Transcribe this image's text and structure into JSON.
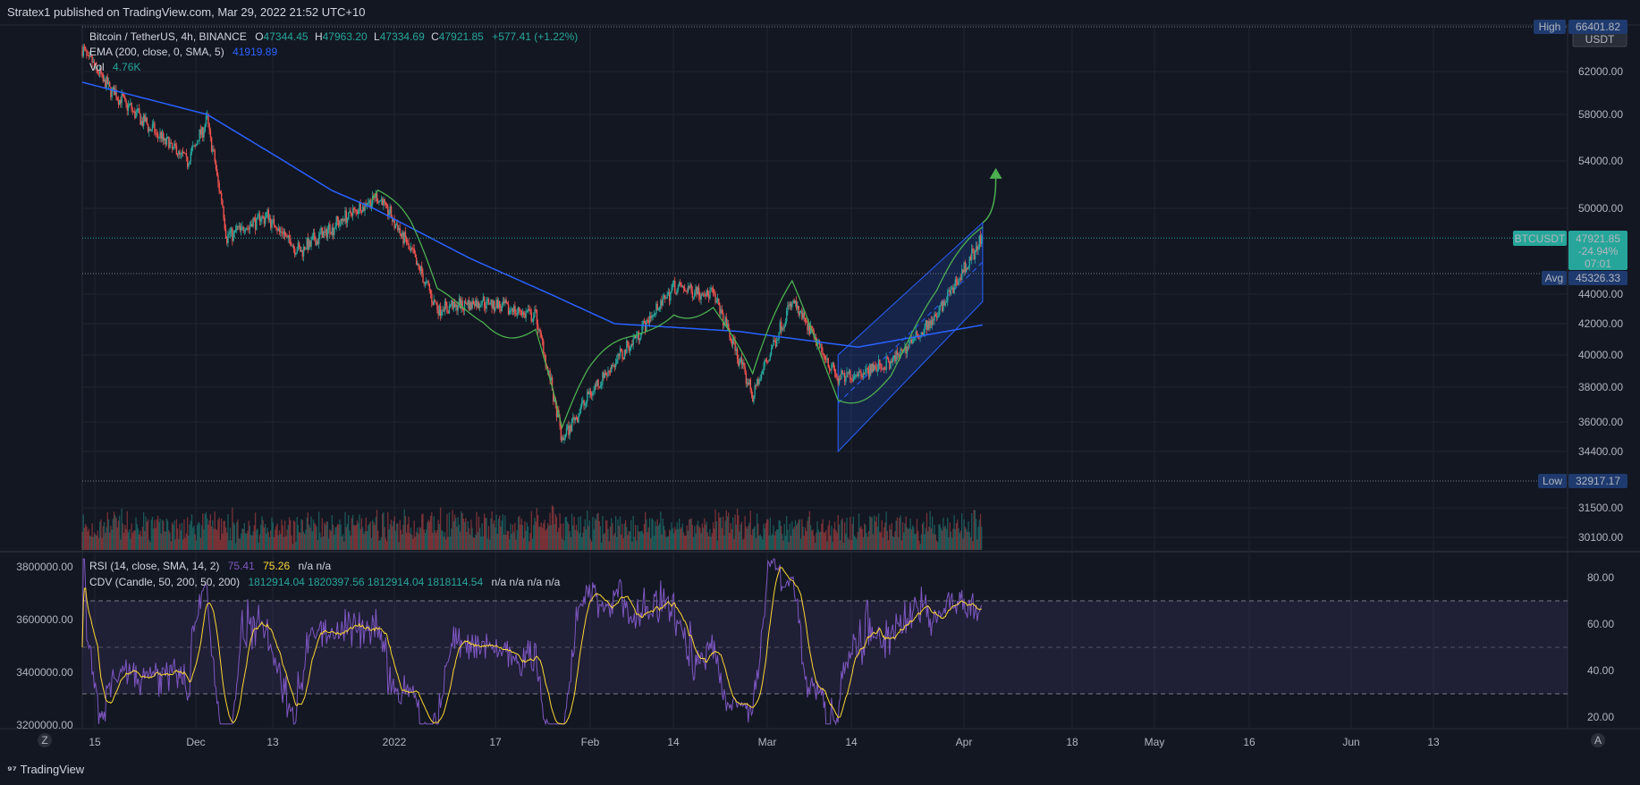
{
  "publisher": "Stratex1 published on TradingView.com, Mar 29, 2022 21:52 UTC+10",
  "footer_brand": "TradingView",
  "legend": {
    "symbol": "Bitcoin / TetherUS, 4h, BINANCE",
    "ohlc_o_label": "O",
    "ohlc_o": "47344.45",
    "ohlc_h_label": "H",
    "ohlc_h": "47963.20",
    "ohlc_l_label": "L",
    "ohlc_l": "47334.69",
    "ohlc_c_label": "C",
    "ohlc_c": "47921.85",
    "change": "+577.41 (+1.22%)",
    "ema_label": "EMA (200, close, 0, SMA, 5)",
    "ema_value": "41919.89",
    "vol_label": "Vol",
    "vol_value": "4.76K",
    "rsi_label": "RSI (14, close, SMA, 14, 2)",
    "rsi_value1": "75.41",
    "rsi_value2": "75.26",
    "rsi_na": "n/a n/a",
    "cdv_label": "CDV (Candle, 50, 200, 50, 200)",
    "cdv_values": "1812914.04 1820397.56 1812914.04 1818114.54",
    "cdv_na": "n/a n/a n/a n/a"
  },
  "price_axis": {
    "currency": "USDT",
    "ticks": [
      "62000.00",
      "58000.00",
      "54000.00",
      "50000.00",
      "44000.00",
      "42000.00",
      "40000.00",
      "38000.00",
      "36000.00",
      "34400.00",
      "31500.00",
      "30100.00"
    ],
    "high_label": "High",
    "high_value": "66401.82",
    "low_label": "Low",
    "low_value": "32917.17",
    "avg_label": "Avg",
    "avg_value": "45326.33",
    "last_symbol": "BTCUSDT",
    "last_price": "47921.85",
    "last_change": "-24.94%",
    "last_countdown": "07:01"
  },
  "rsi_axis": {
    "ticks": [
      "80.00",
      "60.00",
      "40.00",
      "20.00"
    ]
  },
  "cdv_axis": {
    "ticks": [
      "3800000.00",
      "3600000.00",
      "3400000.00",
      "3200000.00"
    ]
  },
  "time_axis": {
    "ticks": [
      "15",
      "Dec",
      "13",
      "2022",
      "17",
      "Feb",
      "14",
      "Mar",
      "14",
      "Apr",
      "18",
      "May",
      "16",
      "Jun",
      "13"
    ]
  },
  "axis_buttons": {
    "left": "Z",
    "right": "A"
  },
  "colors": {
    "background": "#131722",
    "up": "#26a69a",
    "down": "#ef5350",
    "ema": "#2962ff",
    "envelope": "#4caf50",
    "rsi": "#7e57c2",
    "rsi_ma": "#fdd835",
    "channel": "#2962ff"
  },
  "chart_data": {
    "type": "candlestick",
    "x_range": [
      "2021-11-12",
      "2022-06-26"
    ],
    "price_range": [
      29500,
      66401.82
    ],
    "price_key_points": [
      {
        "date": "2021-11-12",
        "price": 64000
      },
      {
        "date": "2021-11-16",
        "price": 60500
      },
      {
        "date": "2021-11-22",
        "price": 57000
      },
      {
        "date": "2021-11-28",
        "price": 54000
      },
      {
        "date": "2021-12-01",
        "price": 57500
      },
      {
        "date": "2021-12-04",
        "price": 48000
      },
      {
        "date": "2021-12-10",
        "price": 49500
      },
      {
        "date": "2021-12-15",
        "price": 47000
      },
      {
        "date": "2021-12-27",
        "price": 51000
      },
      {
        "date": "2022-01-01",
        "price": 47000
      },
      {
        "date": "2022-01-05",
        "price": 43000
      },
      {
        "date": "2022-01-12",
        "price": 43500
      },
      {
        "date": "2022-01-20",
        "price": 42500
      },
      {
        "date": "2022-01-24",
        "price": 35000
      },
      {
        "date": "2022-01-28",
        "price": 37500
      },
      {
        "date": "2022-02-04",
        "price": 41000
      },
      {
        "date": "2022-02-10",
        "price": 44500
      },
      {
        "date": "2022-02-16",
        "price": 44000
      },
      {
        "date": "2022-02-22",
        "price": 37500
      },
      {
        "date": "2022-02-28",
        "price": 43500
      },
      {
        "date": "2022-03-07",
        "price": 38500
      },
      {
        "date": "2022-03-15",
        "price": 39500
      },
      {
        "date": "2022-03-22",
        "price": 42500
      },
      {
        "date": "2022-03-29",
        "price": 47921.85
      }
    ],
    "ema200_points": [
      {
        "date": "2021-11-12",
        "price": 61000
      },
      {
        "date": "2021-12-01",
        "price": 58000
      },
      {
        "date": "2021-12-20",
        "price": 51500
      },
      {
        "date": "2022-01-10",
        "price": 46500
      },
      {
        "date": "2022-02-01",
        "price": 42000
      },
      {
        "date": "2022-02-20",
        "price": 41500
      },
      {
        "date": "2022-03-10",
        "price": 40500
      },
      {
        "date": "2022-03-29",
        "price": 41919.89
      }
    ],
    "rsi_range": [
      15,
      90
    ],
    "rsi_levels": [
      70,
      50,
      30
    ],
    "rsi_last": 75.41,
    "rsi_ma_last": 75.26
  }
}
